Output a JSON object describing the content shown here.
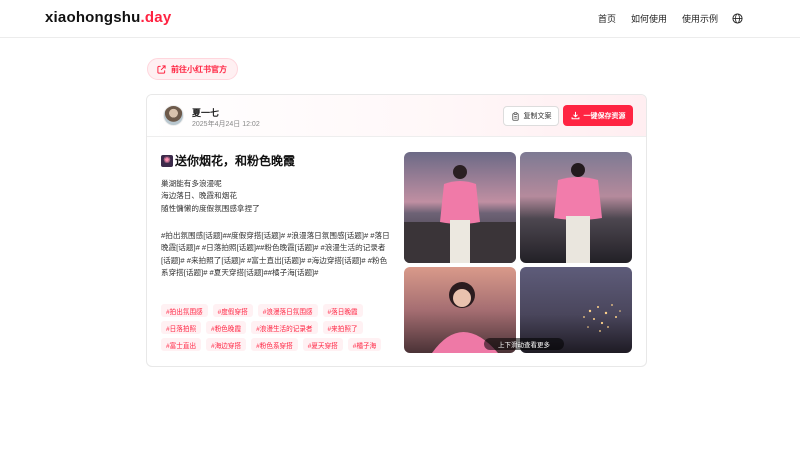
{
  "header": {
    "logo_main": "xiaohongshu",
    "logo_accent": ".day",
    "nav": [
      "首页",
      "如何使用",
      "使用示例"
    ],
    "globe_icon": "globe-icon"
  },
  "official_button": {
    "label": "前往小红书官方",
    "icon": "external-link-icon"
  },
  "post": {
    "author": "夏一七",
    "date": "2025年4月24日 12:02",
    "copy_label": "复制文案",
    "save_label": "一键保存资源",
    "title": "送你烟花，和粉色晚霞",
    "body_lines": [
      "巢湖能有多浪漫呢",
      "海边落日、晚霞和烟花",
      "随性慵懒的度假氛围感拿捏了"
    ],
    "tags_text": "#拍出氛围感[话题]##度假穿搭[话题]#  #浪漫落日氛围感[话题]# #落日晚霞[话题]# #日落拍照[话题]##粉色晚霞[话题]# #浪漫生活的记录者[话题]# #来拍照了[话题]# #富士直出[话题]# #海边穿搭[话题]# #粉色系穿搭[话题]# #夏天穿搭[话题]##橘子海[话题]#",
    "chips": [
      "#拍出氛围感",
      "#度假穿搭",
      "#浪漫落日氛围感",
      "#落日晚霞",
      "#日落拍照",
      "#粉色晚霞",
      "#浪漫生活的记录者",
      "#来拍照了",
      "#富士直出",
      "#海边穿搭",
      "#粉色系穿搭",
      "#夏天穿搭",
      "#橘子海"
    ],
    "scroll_hint": "上下滑动查看更多"
  },
  "colors": {
    "accent": "#ff2442",
    "chip_bg": "#fff1f3"
  }
}
